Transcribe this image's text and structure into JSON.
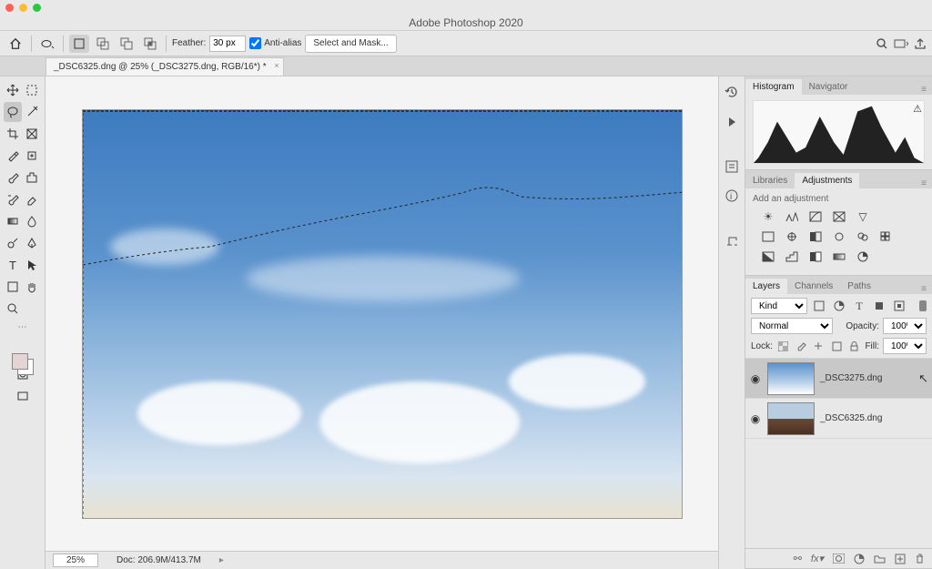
{
  "app_title": "Adobe Photoshop 2020",
  "doc_tab": "_DSC6325.dng @ 25% (_DSC3275.dng, RGB/16*) *",
  "optbar": {
    "feather_label": "Feather:",
    "feather_value": "30 px",
    "antialias": "Anti-alias",
    "select_mask": "Select and Mask..."
  },
  "status": {
    "zoom": "25%",
    "doc": "Doc: 206.9M/413.7M"
  },
  "panels": {
    "histogram": {
      "tabs": [
        "Histogram",
        "Navigator"
      ],
      "active": 0
    },
    "adjustments": {
      "tabs": [
        "Libraries",
        "Adjustments"
      ],
      "active": 1,
      "heading": "Add an adjustment"
    },
    "layers": {
      "tabs": [
        "Layers",
        "Channels",
        "Paths"
      ],
      "active": 0,
      "kind_label": "Kind",
      "blend": "Normal",
      "opacity_label": "Opacity:",
      "opacity": "100%",
      "lock_label": "Lock:",
      "fill_label": "Fill:",
      "fill": "100%",
      "items": [
        {
          "name": "_DSC3275.dng",
          "selected": true,
          "thumb": "sky"
        },
        {
          "name": "_DSC6325.dng",
          "selected": false,
          "thumb": "land"
        }
      ]
    }
  }
}
